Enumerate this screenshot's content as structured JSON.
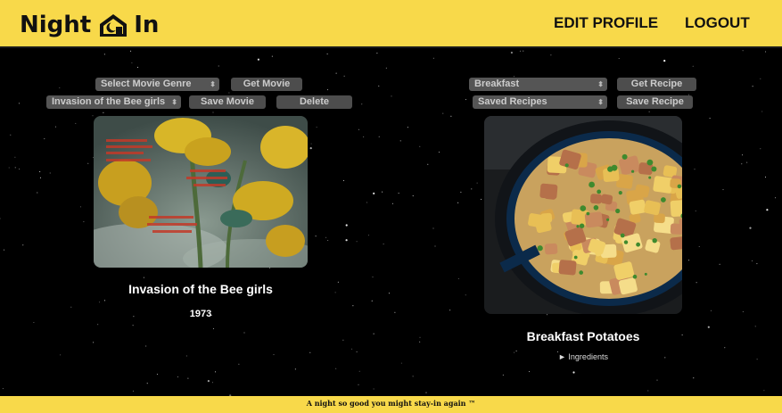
{
  "header": {
    "logo_left": "Night",
    "logo_right": "In",
    "edit_profile": "EDIT PROFILE",
    "logout": "LOGOUT"
  },
  "movie": {
    "genre_select": "Select Movie Genre",
    "get_movie_button": "Get Movie",
    "saved_movie_select": "Invasion of the Bee girls",
    "save_movie_button": "Save Movie",
    "delete_button": "Delete",
    "title": "Invasion of the Bee girls",
    "year": "1973"
  },
  "recipe": {
    "meal_select": "Breakfast",
    "get_recipe_button": "Get Recipe",
    "saved_recipes_select": "Saved Recipes",
    "save_recipe_button": "Save Recipe",
    "title": "Breakfast Potatoes",
    "ingredients_toggle": "► Ingredients"
  },
  "footer": {
    "tagline": "A night so good you might stay-in again ™"
  },
  "colors": {
    "brand_yellow": "#f8d94a",
    "background": "#000000",
    "control_gray": "#555555"
  }
}
